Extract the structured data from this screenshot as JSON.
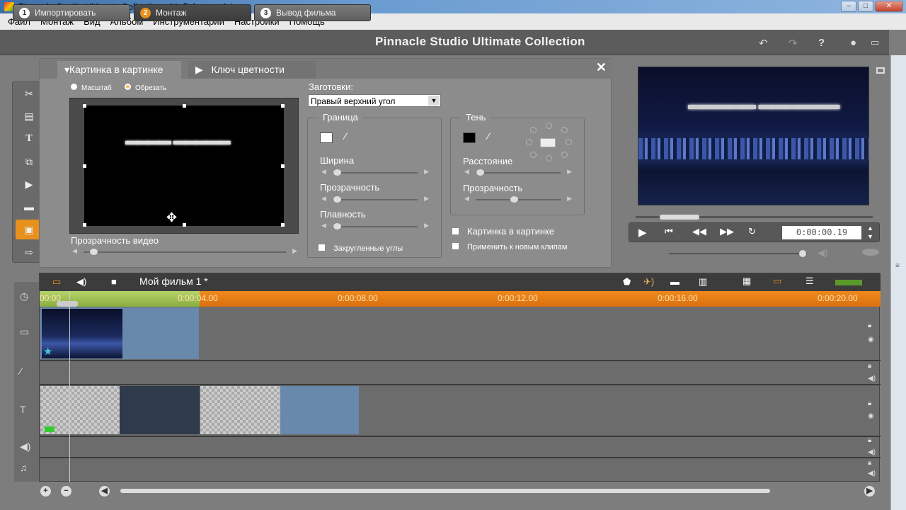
{
  "window": {
    "title": "Pinnacle Studio Ultimate Collection - Мой фильм 1 *"
  },
  "menu": [
    "Файл",
    "Монтаж",
    "Вид",
    "Альбом",
    "Инструментарий",
    "Настройки",
    "Помощь"
  ],
  "steps": [
    {
      "num": "1",
      "label": "Импортировать"
    },
    {
      "num": "2",
      "label": "Монтаж"
    },
    {
      "num": "3",
      "label": "Вывод фильма"
    }
  ],
  "app_title": "Pinnacle Studio Ultimate Collection",
  "panel": {
    "tabs": [
      "Картинка в картинке",
      "Ключ цветности"
    ],
    "mode_scale": "Масштаб",
    "mode_crop": "Обрезать",
    "video_opacity_label": "Прозрачность видео",
    "video_opacity_value": 0.05,
    "presets_label": "Заготовки:",
    "preset_value": "Правый верхний угол",
    "border": {
      "title": "Граница",
      "width_label": "Ширина",
      "width_value": 0.05,
      "opacity_label": "Прозрачность",
      "opacity_value": 0.05,
      "smooth_label": "Плавность",
      "smooth_value": 0.05,
      "rounded_label": "Закругленные углы",
      "color": "#ffffff"
    },
    "shadow": {
      "title": "Тень",
      "distance_label": "Расстояние",
      "distance_value": 0.05,
      "opacity_label": "Прозрачность",
      "opacity_value": 0.45,
      "color": "#000000"
    },
    "pip_checkbox": "Картинка в картинке",
    "apply_new_checkbox": "Применить к новым клипам"
  },
  "player": {
    "timecode": "0:00:00.19",
    "scrub_position": 0.1,
    "volume": 0.97
  },
  "timeline": {
    "project_name": "Мой фильм 1 *",
    "ticks": [
      "00:00",
      "0:00:04.00",
      "0:00:08.00",
      "0:00:12.00",
      "0:00:16.00",
      "0:00:20.00"
    ]
  },
  "colors": {
    "accent": "#e8901c",
    "ruler_green": "#a0c455",
    "clip_blue": "#6888ac"
  }
}
